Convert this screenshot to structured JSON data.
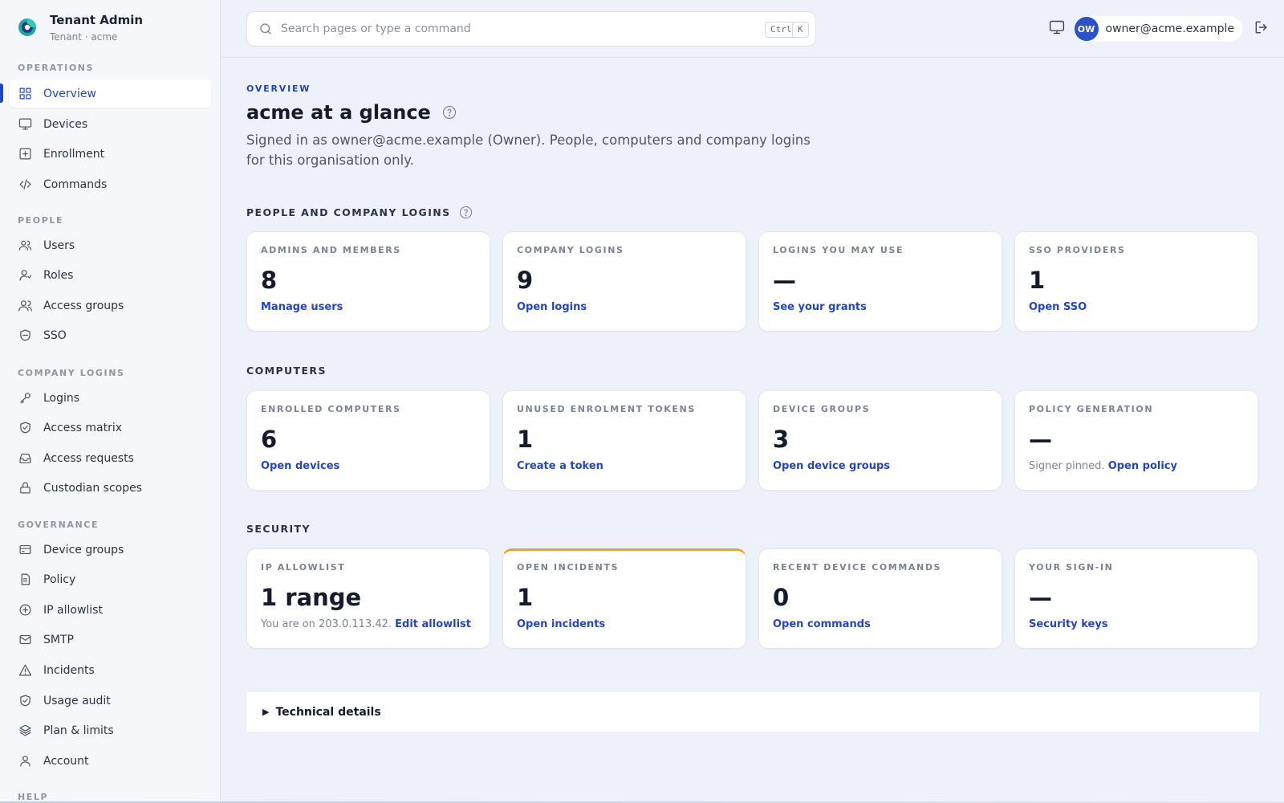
{
  "app": {
    "title": "Tenant Admin",
    "subtitle": "Tenant · acme"
  },
  "sidebar": {
    "sections": [
      {
        "label": "OPERATIONS",
        "items": [
          {
            "label": "Overview",
            "icon": "grid-icon",
            "active": true
          },
          {
            "label": "Devices",
            "icon": "monitor-icon"
          },
          {
            "label": "Enrollment",
            "icon": "plus-square-icon"
          },
          {
            "label": "Commands",
            "icon": "code-icon"
          }
        ]
      },
      {
        "label": "PEOPLE",
        "items": [
          {
            "label": "Users",
            "icon": "users-icon"
          },
          {
            "label": "Roles",
            "icon": "user-role-icon"
          },
          {
            "label": "Access groups",
            "icon": "user-group-icon"
          },
          {
            "label": "SSO",
            "icon": "shield-minus-icon"
          }
        ]
      },
      {
        "label": "COMPANY LOGINS",
        "items": [
          {
            "label": "Logins",
            "icon": "key-icon"
          },
          {
            "label": "Access matrix",
            "icon": "shield-check-icon"
          },
          {
            "label": "Access requests",
            "icon": "inbox-icon"
          },
          {
            "label": "Custodian scopes",
            "icon": "lock-icon"
          }
        ]
      },
      {
        "label": "GOVERNANCE",
        "items": [
          {
            "label": "Device groups",
            "icon": "card-icon"
          },
          {
            "label": "Policy",
            "icon": "document-icon"
          },
          {
            "label": "IP allowlist",
            "icon": "plus-circle-icon"
          },
          {
            "label": "SMTP",
            "icon": "mail-icon"
          },
          {
            "label": "Incidents",
            "icon": "warning-icon"
          },
          {
            "label": "Usage audit",
            "icon": "shield-check-icon"
          },
          {
            "label": "Plan & limits",
            "icon": "layers-icon"
          },
          {
            "label": "Account",
            "icon": "user-icon"
          }
        ]
      },
      {
        "label": "HELP",
        "items": []
      }
    ]
  },
  "topbar": {
    "search_placeholder": "Search pages or type a command",
    "shortcut_ctrl": "Ctrl",
    "shortcut_k": "K",
    "user_initials": "OW",
    "user_email": "owner@acme.example"
  },
  "page": {
    "eyebrow": "OVERVIEW",
    "title": "acme at a glance",
    "description": "Signed in as owner@acme.example (Owner). People, computers and company logins for this organisation only."
  },
  "sections": [
    {
      "label": "PEOPLE AND COMPANY LOGINS",
      "help": true,
      "cards": [
        {
          "label": "ADMINS AND MEMBERS",
          "value": "8",
          "note": "",
          "link": "Manage users"
        },
        {
          "label": "COMPANY LOGINS",
          "value": "9",
          "note": "",
          "link": "Open logins"
        },
        {
          "label": "LOGINS YOU MAY USE",
          "value": "—",
          "note": "",
          "link": "See your grants"
        },
        {
          "label": "SSO PROVIDERS",
          "value": "1",
          "note": "",
          "link": "Open SSO"
        }
      ]
    },
    {
      "label": "COMPUTERS",
      "help": false,
      "cards": [
        {
          "label": "ENROLLED COMPUTERS",
          "value": "6",
          "note": "",
          "link": "Open devices"
        },
        {
          "label": "UNUSED ENROLMENT TOKENS",
          "value": "1",
          "note": "",
          "link": "Create a token"
        },
        {
          "label": "DEVICE GROUPS",
          "value": "3",
          "note": "",
          "link": "Open device groups"
        },
        {
          "label": "POLICY GENERATION",
          "value": "—",
          "note": "Signer pinned.",
          "link": "Open policy"
        }
      ]
    },
    {
      "label": "SECURITY",
      "help": false,
      "cards": [
        {
          "label": "IP ALLOWLIST",
          "value": "1 range",
          "note": "You are on 203.0.113.42.",
          "link": "Edit allowlist"
        },
        {
          "label": "OPEN INCIDENTS",
          "value": "1",
          "note": "",
          "link": "Open incidents",
          "alert": true,
          "alert_color": "#f0a31b"
        },
        {
          "label": "RECENT DEVICE COMMANDS",
          "value": "0",
          "note": "",
          "link": "Open commands"
        },
        {
          "label": "YOUR SIGN-IN",
          "value": "—",
          "note": "",
          "link": "Security keys"
        }
      ]
    }
  ],
  "technical_details": "Technical details",
  "colors": {
    "accent": "#2546b8",
    "avatar": "#2c52c9",
    "alert": "#f0a31b",
    "background": "#eef1f9"
  }
}
